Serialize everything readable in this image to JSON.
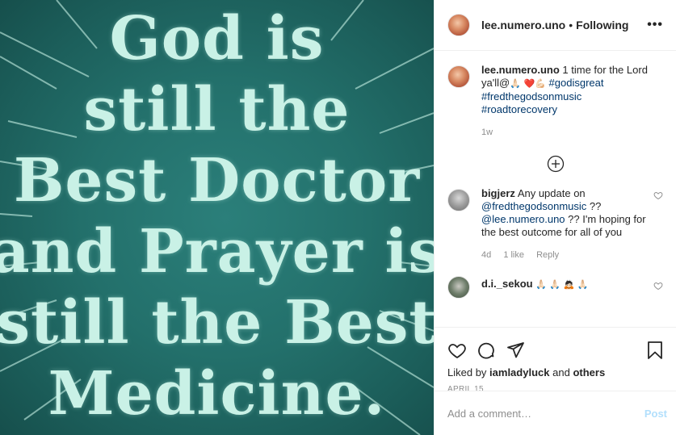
{
  "poster": {
    "lines": [
      "God is",
      "still the",
      "Best Doctor",
      "and Prayer is",
      "still the Best",
      "Medicine."
    ]
  },
  "header": {
    "username": "lee.numero.uno",
    "separator": "•",
    "follow_status": "Following",
    "more": "•••"
  },
  "caption": {
    "username": "lee.numero.uno",
    "text": "1 time for the Lord ya'll@",
    "emojis_a": "🙏🏻",
    "emojis_b": "❤️💪🏻",
    "hashtags": [
      "#godisgreat",
      "#fredthegodsonmusic",
      "#roadtorecovery"
    ],
    "age": "1w"
  },
  "comments": [
    {
      "username": "bigjerz",
      "text_a": "Any update on",
      "mention_a": "@fredthegodsonmusic",
      "text_b": "??",
      "mention_b": "@lee.numero.uno",
      "text_c": "?? I'm hoping for the best outcome for all of you",
      "age": "4d",
      "likes": "1 like",
      "reply": "Reply"
    },
    {
      "username": "d.i._sekou",
      "text": "🙏🏻 🙏🏻 🙇🏻 🙏🏻"
    }
  ],
  "actions": {
    "liked_by_prefix": "Liked by",
    "liked_by_user": "iamladyluck",
    "liked_by_suffix": "and",
    "liked_by_others": "others",
    "date": "APRIL 15"
  },
  "add_comment": {
    "placeholder": "Add a comment…",
    "post_label": "Post"
  },
  "colors": {
    "poster_bg": "#23706b",
    "poster_text": "#c9f1e6",
    "link": "#00376b",
    "post_button": "#b2dffc",
    "heart_red": "#ed4956"
  }
}
